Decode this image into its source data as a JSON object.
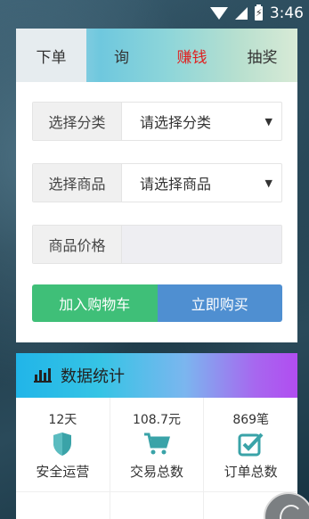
{
  "status_bar": {
    "time": "3:46",
    "battery_glyph": "⚡"
  },
  "tabs": [
    {
      "label": "下单",
      "active": true
    },
    {
      "label": "询",
      "active": false
    },
    {
      "label": "赚钱",
      "active": false,
      "color": "#e02020"
    },
    {
      "label": "抽奖",
      "active": false
    }
  ],
  "form": {
    "category": {
      "label": "选择分类",
      "value": "请选择分类"
    },
    "product": {
      "label": "选择商品",
      "value": "请选择商品"
    },
    "price": {
      "label": "商品价格",
      "value": ""
    }
  },
  "buttons": {
    "add_to_cart": "加入购物车",
    "buy_now": "立即购买"
  },
  "stats": {
    "title": "数据统计",
    "items": [
      {
        "value": "12天",
        "label": "安全运营",
        "icon": "shield-icon"
      },
      {
        "value": "108.7元",
        "label": "交易总数",
        "icon": "cart-icon"
      },
      {
        "value": "869笔",
        "label": "订单总数",
        "icon": "checkbox-icon"
      }
    ]
  },
  "colors": {
    "accent_green": "#3fbf78",
    "accent_blue": "#4f8fd1",
    "icon_teal": "#3aa3a8",
    "tab_red": "#e02020"
  }
}
